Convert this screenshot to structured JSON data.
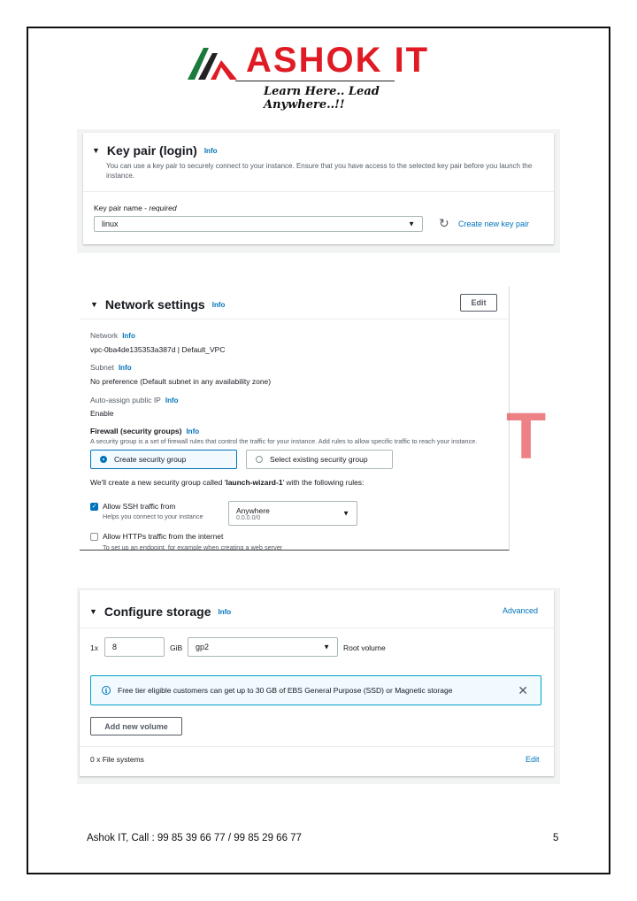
{
  "logo": {
    "brand": "ASHOK IT",
    "tagline": "Learn Here.. Lead Anywhere..!!",
    "colors": {
      "red": "#e01b24",
      "green": "#1a7a3b",
      "dark": "#222222"
    }
  },
  "key_pair": {
    "title": "Key pair (login)",
    "info": "Info",
    "description": "You can use a key pair to securely connect to your instance. Ensure that you have access to the selected key pair before you launch the instance.",
    "field_label": "Key pair name - ",
    "field_required": "required",
    "selected": "linux",
    "refresh_icon": "refresh-icon",
    "create_link": "Create new key pair"
  },
  "network": {
    "title": "Network settings",
    "info": "Info",
    "edit_button": "Edit",
    "network_label": "Network",
    "network_value": "vpc-0ba4de135353a387d | Default_VPC",
    "subnet_label": "Subnet",
    "subnet_value": "No preference (Default subnet in any availability zone)",
    "public_ip_label": "Auto-assign public IP",
    "public_ip_value": "Enable",
    "firewall_label": "Firewall (security groups)",
    "firewall_desc": "A security group is a set of firewall rules that control the traffic for your instance. Add rules to allow specific traffic to reach your instance.",
    "option_create": "Create security group",
    "option_existing": "Select existing security group",
    "new_sg_prefix": "We'll create a new security group called '",
    "new_sg_name": "launch-wizard-1",
    "new_sg_suffix": "' with the following rules:",
    "ssh_label": "Allow SSH traffic from",
    "ssh_help": "Helps you connect to your instance",
    "ssh_source": "Anywhere",
    "ssh_cidr": "0.0.0.0/0",
    "https_label": "Allow HTTPs traffic from the internet",
    "https_help": "To set up an endpoint, for example when creating a web server",
    "watermark": "T"
  },
  "storage": {
    "title": "Configure storage",
    "info": "Info",
    "advanced": "Advanced",
    "count": "1x",
    "size": "8",
    "unit": "GiB",
    "volume_type": "gp2",
    "root_label": "Root volume",
    "notice": "Free tier eligible customers can get up to 30 GB of EBS General Purpose (SSD) or Magnetic storage",
    "add_volume": "Add new volume",
    "file_systems": "0 x File systems",
    "edit": "Edit"
  },
  "footer": {
    "contact": "Ashok IT, Call : 99 85 39 66 77 / 99 85 29 66 77",
    "page_number": "5"
  }
}
